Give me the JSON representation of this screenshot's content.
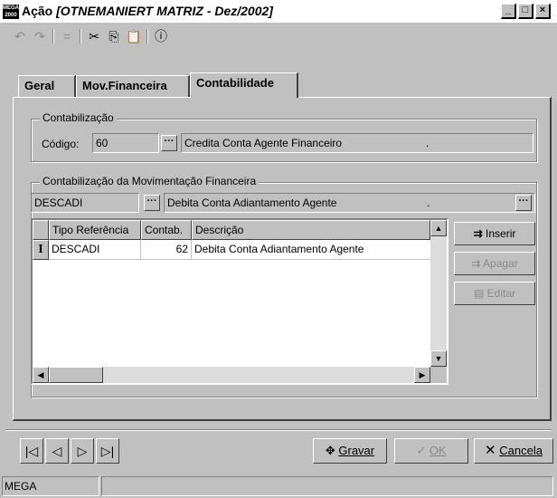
{
  "window": {
    "app_icon_text": "MEGA 2000",
    "title_prefix": "Ação",
    "title_context": "[OTNEMANIERT MATRIZ - Dez/2002]",
    "controls": [
      "_",
      "□",
      "×"
    ]
  },
  "toolbar": {
    "undo": "↶",
    "redo": "↷",
    "minus": "=",
    "cut": "✂",
    "copy": "⎘",
    "paste": "📋",
    "info": "ⓘ"
  },
  "tabs": [
    {
      "label": "Geral"
    },
    {
      "label": "Mov.Financeira"
    },
    {
      "label": "Contabilidade"
    }
  ],
  "contabilizacao": {
    "group_title": "Contabilização",
    "codigo_label": "Código:",
    "codigo_value": "60",
    "ellipsis": "···",
    "descricao": "Credita Conta Agente Financeiro",
    "descricao_suffix": "."
  },
  "mov_fin": {
    "group_title": "Contabilização da Movimentação Financeira",
    "tipo_value": "DESCADI",
    "ellipsis": "···",
    "descricao": "Debita Conta Adiantamento Agente",
    "descricao_suffix": ".",
    "grid": {
      "columns": [
        "Tipo Referência",
        "Contab.",
        "Descrição"
      ],
      "rows": [
        {
          "indicator": "I",
          "tipo": "DESCADI",
          "contab": "62",
          "descricao": "Debita Conta Adiantamento Agente"
        }
      ]
    },
    "buttons": {
      "inserir": "Inserir",
      "apagar": "Apagar",
      "editar": "Editar"
    }
  },
  "bottom": {
    "nav": [
      "|◁",
      "◁",
      "▷",
      "▷|"
    ],
    "gravar": "Gravar",
    "ok": "OK",
    "cancelar": "Cancela"
  },
  "status": {
    "company": "MEGA"
  }
}
